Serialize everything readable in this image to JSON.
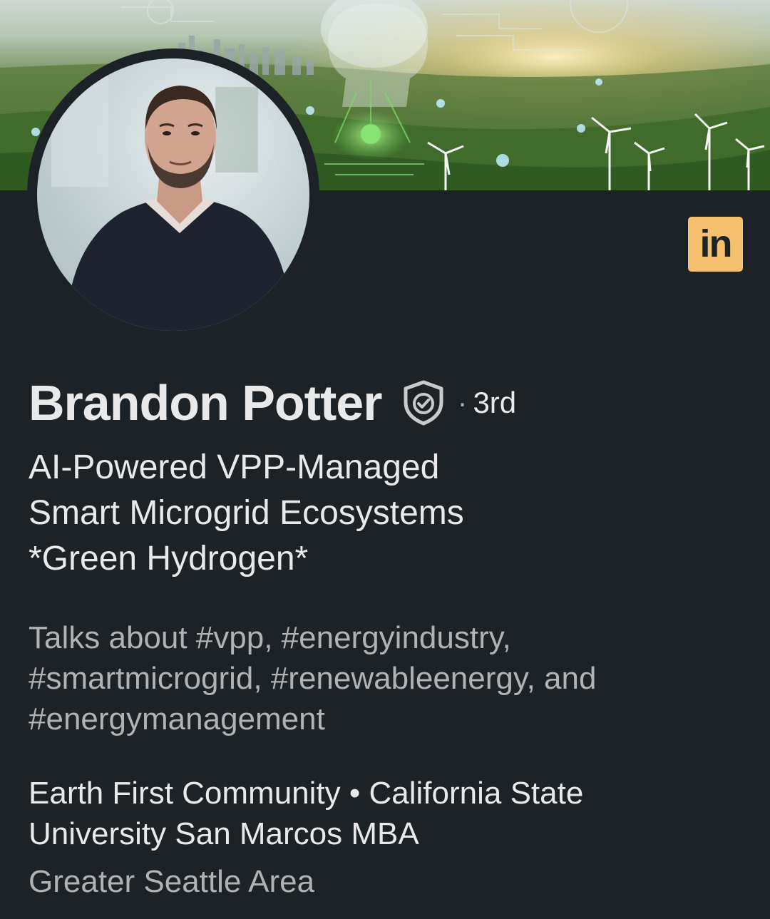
{
  "profile": {
    "name": "Brandon Potter",
    "degree_separator": "·",
    "degree": "3rd",
    "headline_lines": [
      "AI-Powered VPP-Managed",
      "Smart Microgrid Ecosystems",
      "*Green Hydrogen*"
    ],
    "talks_about_lines": [
      "Talks about #vpp, #energyindustry,",
      "#smartmicrogrid, #renewableenergy, and",
      "#energymanagement"
    ],
    "organization_lines": [
      "Earth First Community • California State",
      "University San Marcos MBA"
    ],
    "location": "Greater Seattle Area"
  },
  "badge": {
    "label": "in",
    "icon": "linkedin-icon",
    "color": "#f5c170"
  },
  "icons": {
    "verified": "verified-shield-icon"
  },
  "colors": {
    "background": "#1d2226",
    "primary_text": "#e9e9e9",
    "secondary_text": "#b0b3b5"
  }
}
